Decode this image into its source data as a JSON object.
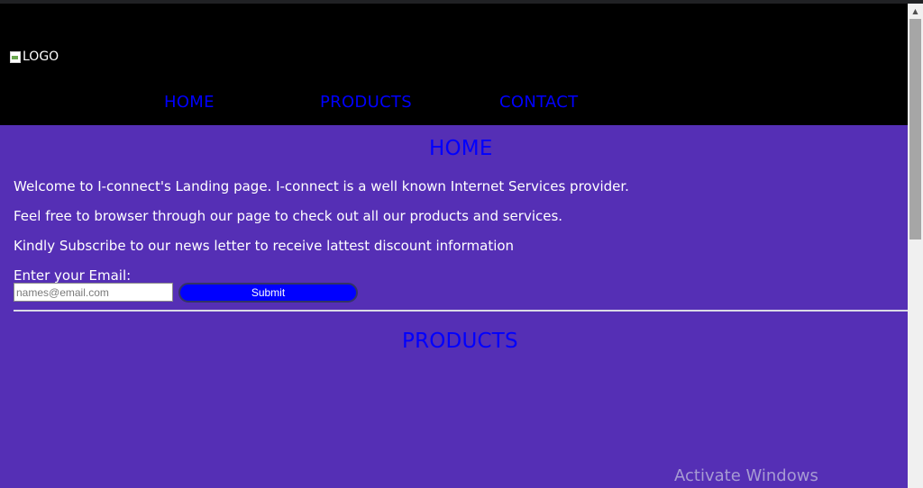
{
  "logo": {
    "alt_text": "LOGO"
  },
  "nav": {
    "items": [
      {
        "label": "HOME"
      },
      {
        "label": "PRODUCTS"
      },
      {
        "label": "CONTACT"
      }
    ]
  },
  "home_section": {
    "title": "HOME",
    "paragraphs": [
      "Welcome to I-connect's Landing page. I-connect is a well known Internet Services provider.",
      "Feel free to browser through our page to check out all our products and services.",
      "Kindly Subscribe to our news letter to receive lattest discount information"
    ],
    "email_label": "Enter your Email:",
    "email_placeholder": "names@email.com",
    "email_value": "",
    "submit_label": "Submit"
  },
  "products_section": {
    "title": "PRODUCTS"
  },
  "watermark": "Activate Windows",
  "colors": {
    "page_background": "#552fb5",
    "header_background": "#000000",
    "link": "#0000ff",
    "button": "#0000ff"
  }
}
